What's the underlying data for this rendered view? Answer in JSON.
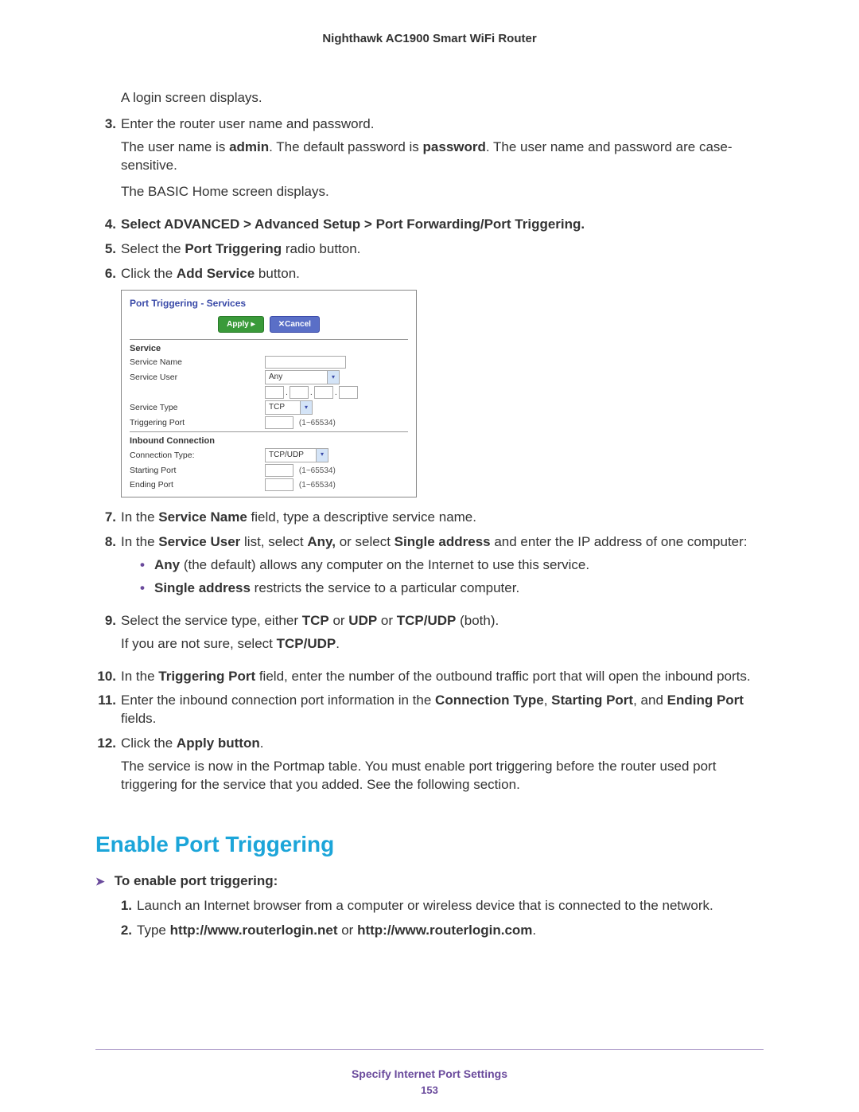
{
  "header": {
    "title": "Nighthawk AC1900 Smart WiFi Router"
  },
  "steps": {
    "login_para": "A login screen displays.",
    "s3": {
      "num": "3.",
      "text": "Enter the router user name and password."
    },
    "s3_p1_a": "The user name is ",
    "s3_p1_admin": "admin",
    "s3_p1_b": ". The default password is ",
    "s3_p1_pw": "password",
    "s3_p1_c": ". The user name and password are case-sensitive.",
    "s3_p2": "The BASIC Home screen displays.",
    "s4": {
      "num": "4.",
      "text": "Select ADVANCED > Advanced Setup > Port Forwarding/Port Triggering."
    },
    "s5": {
      "num": "5.",
      "a": "Select the ",
      "b": "Port Triggering",
      "c": " radio button."
    },
    "s6": {
      "num": "6.",
      "a": "Click the ",
      "b": "Add Service",
      "c": " button."
    },
    "s7": {
      "num": "7.",
      "a": "In the ",
      "b": "Service Name",
      "c": " field, type a descriptive service name."
    },
    "s8": {
      "num": "8.",
      "a": "In the ",
      "b": "Service User",
      "c": " list, select ",
      "d": "Any,",
      "e": " or select ",
      "f": "Single address",
      "g": " and enter the IP address of one computer:"
    },
    "s8_b1": {
      "a": "Any",
      "b": " (the default) allows any computer on the Internet to use this service."
    },
    "s8_b2": {
      "a": "Single address",
      "b": " restricts the service to a particular computer."
    },
    "s9": {
      "num": "9.",
      "a": "Select the service type, either ",
      "b": "TCP",
      "c": " or ",
      "d": "UDP",
      "e": " or ",
      "f": "TCP/UDP",
      "g": " (both)."
    },
    "s9_p1_a": "If you are not sure, select ",
    "s9_p1_b": "TCP/UDP",
    "s9_p1_c": ".",
    "s10": {
      "num": "10.",
      "a": "In the ",
      "b": "Triggering Port",
      "c": " field, enter the number of the outbound traffic port that will open the inbound ports."
    },
    "s11": {
      "num": "11.",
      "a": "Enter the inbound connection port information in the ",
      "b": "Connection Type",
      "c": ", ",
      "d": "Starting Port",
      "e": ", and ",
      "f": "Ending Port",
      "g": " fields."
    },
    "s12": {
      "num": "12.",
      "a": "Click the ",
      "b": "Apply button",
      "c": "."
    },
    "s12_p1": "The service is now in the Portmap table. You must enable port triggering before the router used port triggering for the service that you added. See the following section."
  },
  "ui": {
    "title": "Port Triggering - Services",
    "apply": "Apply ▸",
    "cancel": "✕Cancel",
    "section1": "Service",
    "service_name": "Service Name",
    "service_user": "Service User",
    "service_user_val": "Any",
    "service_type": "Service Type",
    "service_type_val": "TCP",
    "triggering_port": "Triggering Port",
    "range_hint": "(1~65534)",
    "section2": "Inbound Connection",
    "conn_type": "Connection Type:",
    "conn_type_val": "TCP/UDP",
    "starting_port": "Starting Port",
    "ending_port": "Ending Port",
    "dot": "."
  },
  "section": {
    "heading": "Enable Port Triggering",
    "lead_arrow": "➤",
    "lead": "To enable port triggering:",
    "e1": {
      "num": "1.",
      "text": "Launch an Internet browser from a computer or wireless device that is connected to the network."
    },
    "e2": {
      "num": "2.",
      "a": "Type ",
      "b": "http://www.routerlogin.net",
      "c": " or ",
      "d": "http://www.routerlogin.com",
      "e": "."
    }
  },
  "footer": {
    "text": "Specify Internet Port Settings",
    "page": "153"
  }
}
